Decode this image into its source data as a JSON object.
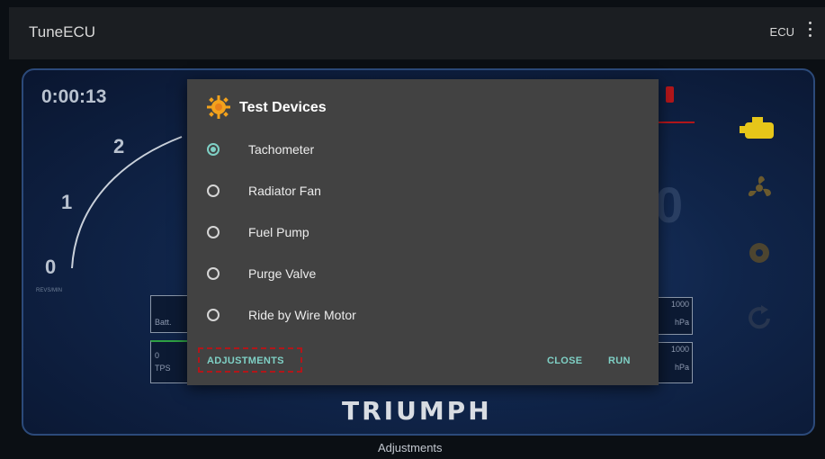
{
  "appbar": {
    "title": "TuneECU",
    "ecu_label": "ECU"
  },
  "dashboard": {
    "timer": "0:00:13",
    "gauge_ticks": [
      "2",
      "1",
      "0"
    ],
    "gauge_caption": "REVS/MIN",
    "batt_label": "Batt.",
    "tps_value": "0",
    "tps_label": "TPS",
    "pressure_value_1": "1000",
    "pressure_unit_1": "hPa",
    "pressure_value_2": "1000",
    "pressure_unit_2": "hPa",
    "brand": "TRIUMPH",
    "footer": "Adjustments",
    "accent_color": "#b2161a"
  },
  "dialog": {
    "title": "Test Devices",
    "title_icon": "sun-icon",
    "options": [
      {
        "label": "Tachometer",
        "checked": true
      },
      {
        "label": "Radiator Fan",
        "checked": false
      },
      {
        "label": "Fuel Pump",
        "checked": false
      },
      {
        "label": "Purge Valve",
        "checked": false
      },
      {
        "label": "Ride by Wire Motor",
        "checked": false
      }
    ],
    "buttons": {
      "adjustments": "ADJUSTMENTS",
      "close": "CLOSE",
      "run": "RUN"
    },
    "accent_color": "#7fd0c5"
  },
  "right_icons": [
    "engine-icon",
    "fan-icon",
    "gear-icon",
    "refresh-icon"
  ]
}
